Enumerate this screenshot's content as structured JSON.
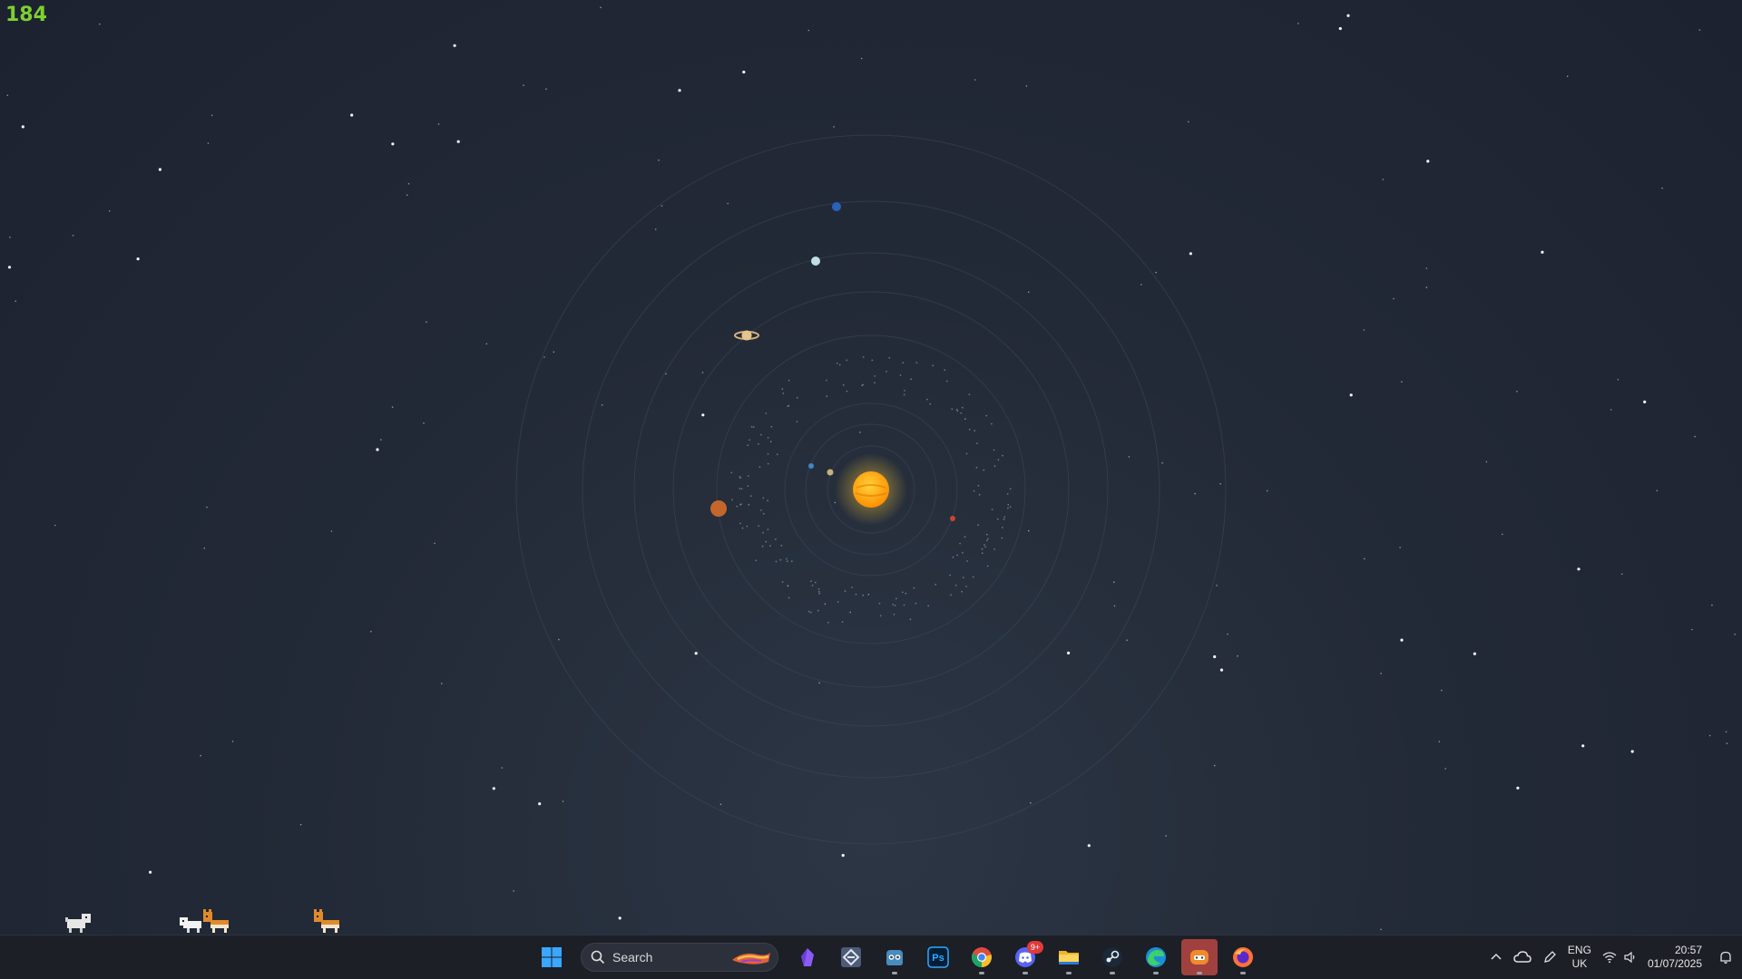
{
  "overlay": {
    "fps_counter": "184"
  },
  "wallpaper": {
    "planets": [
      {
        "name": "mercury",
        "color": "#c9b27a"
      },
      {
        "name": "venus",
        "color": "#3f86c9"
      },
      {
        "name": "earth",
        "color": "#c94436"
      },
      {
        "name": "mars",
        "color": "#c4662c"
      },
      {
        "name": "saturn",
        "color": "#d8b07a"
      },
      {
        "name": "uranus",
        "color": "#bfdfe8"
      },
      {
        "name": "neptune",
        "color": "#2b62b8"
      }
    ],
    "sun_color": "#ffa30f"
  },
  "taskbar": {
    "search_placeholder": "Search",
    "apps": [
      {
        "name": "start-button",
        "icon": "windows-logo-icon",
        "running": false
      },
      {
        "name": "obsidian",
        "icon": "obsidian-icon",
        "running": false
      },
      {
        "name": "vscode-style-app",
        "icon": "diamond-app-icon",
        "running": false
      },
      {
        "name": "godot",
        "icon": "godot-icon",
        "running": true
      },
      {
        "name": "photoshop",
        "icon": "photoshop-icon",
        "running": false
      },
      {
        "name": "chrome",
        "icon": "chrome-icon",
        "running": true
      },
      {
        "name": "discord",
        "icon": "discord-icon",
        "running": true,
        "badge": "9+"
      },
      {
        "name": "file-explorer",
        "icon": "folder-icon",
        "running": true
      },
      {
        "name": "steam",
        "icon": "steam-icon",
        "running": true
      },
      {
        "name": "edge",
        "icon": "edge-icon",
        "running": true
      },
      {
        "name": "pet-app",
        "icon": "orange-app-icon",
        "running": true,
        "active": true
      },
      {
        "name": "firefox",
        "icon": "firefox-icon",
        "running": true
      }
    ],
    "photoshop_label": "Ps",
    "discord_badge": "9+",
    "language": "ENG",
    "region": "UK",
    "time": "20:57",
    "date": "01/07/2025"
  }
}
